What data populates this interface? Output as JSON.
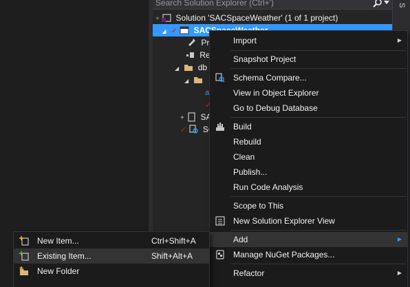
{
  "search": {
    "placeholder": "Search Solution Explorer (Ctrl+')"
  },
  "right_tab": {
    "label": "S"
  },
  "tree": {
    "solution": "Solution 'SACSpaceWeather' (1 of 1 project)",
    "project": "SACSpaceWeather",
    "items": [
      "Pro",
      "Re",
      "db",
      "SA",
      "SC"
    ]
  },
  "context_menu": {
    "items": {
      "import": "Import",
      "snapshot_project": "Snapshot Project",
      "schema_compare": "Schema Compare...",
      "view_object_explorer": "View in Object Explorer",
      "go_debug_database": "Go to Debug Database",
      "build": "Build",
      "rebuild": "Rebuild",
      "clean": "Clean",
      "publish": "Publish...",
      "run_code_analysis": "Run Code Analysis",
      "scope_to_this": "Scope to This",
      "new_solution_explorer_view": "New Solution Explorer View",
      "add": "Add",
      "manage_nuget": "Manage NuGet Packages...",
      "refactor": "Refactor"
    }
  },
  "add_submenu": {
    "new_item": {
      "label": "New Item...",
      "shortcut": "Ctrl+Shift+A"
    },
    "existing_item": {
      "label": "Existing Item...",
      "shortcut": "Shift+Alt+A"
    },
    "new_folder": {
      "label": "New Folder"
    }
  },
  "colors": {
    "accent": "#3399ff",
    "menu_bg": "#1b1b1c",
    "panel_bg": "#252526",
    "editor_bg": "#1e1e1e"
  }
}
